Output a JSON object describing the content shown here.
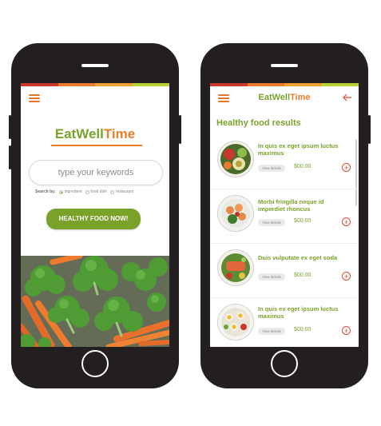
{
  "colors": {
    "brand_green": "#7aa22a",
    "brand_orange": "#ea7d2b",
    "accent_red": "#e04a3a",
    "phone_body": "#231f20",
    "stripe": [
      "#c9392b",
      "#ea7d2b",
      "#f0a033",
      "#b5d334"
    ]
  },
  "brand": {
    "part1": "EatWell",
    "part2": "Time"
  },
  "home": {
    "search_placeholder": "type your keywords",
    "search_by_label": "Search by:",
    "options": [
      {
        "label": "ingredient",
        "selected": true
      },
      {
        "label": "food dish",
        "selected": false
      },
      {
        "label": "restaurant",
        "selected": false
      }
    ],
    "cta_label": "HEALTHY FOOD NOW!"
  },
  "results": {
    "title": "Healthy food results",
    "items": [
      {
        "title": "In quis ex eget ipsum luctus maximus",
        "details_label": "View details",
        "price": "$00.00",
        "image": "salad-avocado"
      },
      {
        "title": "Morbi fringilla neque id imperdiet rhoncus",
        "details_label": "View details",
        "price": "$00.00",
        "image": "shrimp-plate"
      },
      {
        "title": "Duis vulputate ex eget soda",
        "details_label": "View details",
        "price": "$00.00",
        "image": "salmon-salad"
      },
      {
        "title": "In quis ex eget ipsum luctus maximus",
        "details_label": "View details",
        "price": "$00.00",
        "image": "egg-salad"
      }
    ]
  },
  "icons": {
    "menu": "hamburger-icon",
    "back": "arrow-left-icon",
    "add": "plus-circle-icon"
  }
}
